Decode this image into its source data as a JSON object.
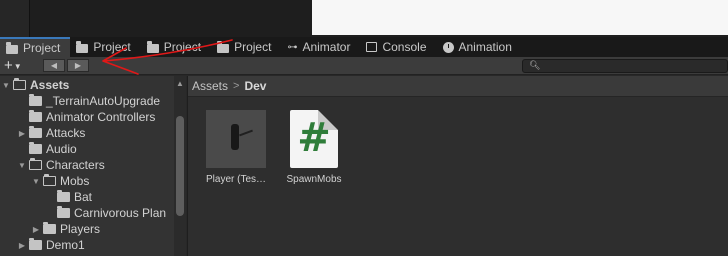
{
  "tabs": [
    {
      "label": "Project",
      "icon": "folder-icon",
      "active": true
    },
    {
      "label": "Project",
      "icon": "folder-icon",
      "active": false
    },
    {
      "label": "Project",
      "icon": "folder-icon",
      "active": false
    },
    {
      "label": "Project",
      "icon": "folder-icon",
      "active": false
    },
    {
      "label": "Animator",
      "icon": "animator-icon",
      "active": false
    },
    {
      "label": "Console",
      "icon": "console-icon",
      "active": false
    },
    {
      "label": "Animation",
      "icon": "animation-icon",
      "active": false
    }
  ],
  "toolbar": {
    "add_label": "+",
    "back_label": "◀",
    "forward_label": "▶",
    "search_placeholder": ""
  },
  "tree": {
    "items": [
      {
        "label": "Assets"
      },
      {
        "label": "_TerrainAutoUpgrade"
      },
      {
        "label": "Animator Controllers"
      },
      {
        "label": "Attacks"
      },
      {
        "label": "Audio"
      },
      {
        "label": "Characters"
      },
      {
        "label": "Mobs"
      },
      {
        "label": "Bat"
      },
      {
        "label": "Carnivorous Plan"
      },
      {
        "label": "Players"
      },
      {
        "label": "Demo1"
      }
    ]
  },
  "breadcrumb": {
    "root": "Assets",
    "separator": ">",
    "current": "Dev"
  },
  "assets": [
    {
      "label": "Player (Tes…",
      "type": "prefab"
    },
    {
      "label": "SpawnMobs",
      "type": "script",
      "glyph": "#"
    }
  ],
  "colors": {
    "accent": "#3a79bb",
    "annotation": "#e01818",
    "script_glyph": "#2f7d3a"
  }
}
